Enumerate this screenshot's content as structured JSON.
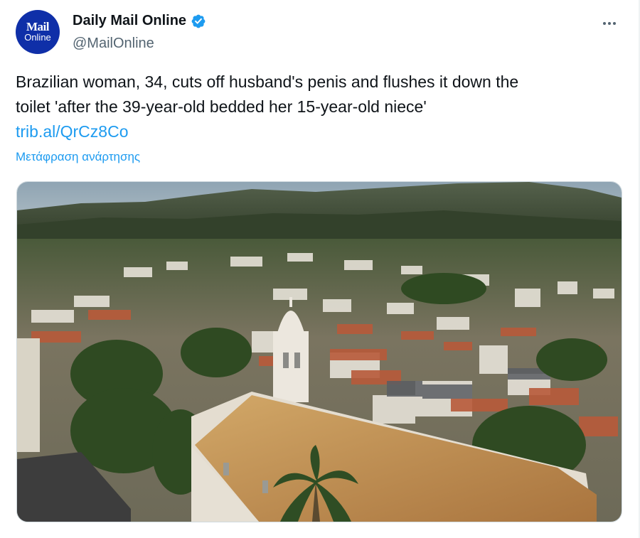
{
  "account": {
    "avatar_line1": "Mail",
    "avatar_line2": "Online",
    "display_name": "Daily Mail Online",
    "handle": "@MailOnline",
    "verified": true
  },
  "icons": {
    "verified": "verified-badge-icon",
    "more": "more-options-icon"
  },
  "tweet": {
    "text_line1": "Brazilian woman, 34, cuts off husband's penis and flushes it down the",
    "text_line2": "toilet 'after the 39-year-old bedded her 15-year-old niece'",
    "link_text": "trib.al/QrCz8Co",
    "translate_label": "Μετάφραση ανάρτησης"
  },
  "colors": {
    "accent": "#1d9bf0",
    "avatar_bg": "#0f2fa8",
    "text": "#0f1419",
    "secondary": "#536471"
  }
}
